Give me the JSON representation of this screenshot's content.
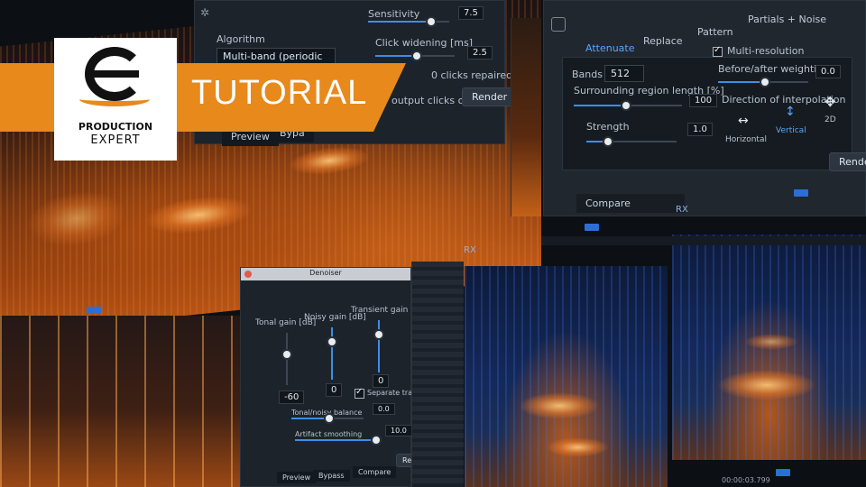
{
  "brand": {
    "logo_line1": "PRODUCTION",
    "logo_line2": "EXPERT",
    "banner_text": "TUTORIAL",
    "banner_color": "#e8891c"
  },
  "declick": {
    "algorithm_label": "Algorithm",
    "algorithm_value": "Multi-band (periodic clicks",
    "sensitivity_label": "Sensitivity",
    "sensitivity_value": "7.5",
    "sensitivity_level": 0.75,
    "click_widening_label": "Click widening [ms]",
    "click_widening_value": "2.5",
    "clicks_repaired": "0 clicks repaired",
    "output_clicks_only": "output clicks only",
    "render_label": "Render",
    "preview_label": "Preview",
    "bypass_label": "Bypa"
  },
  "spectral_repair": {
    "tabs": [
      "Attenuate",
      "Replace",
      "Pattern",
      "Partials + Noise"
    ],
    "active_tab": "Attenuate",
    "bands_label": "Bands",
    "bands_value": "512",
    "multi_resolution_label": "Multi-resolution",
    "surrounding_label": "Surrounding region length [%]",
    "surrounding_value": "100",
    "before_after_label": "Before/after weighting",
    "before_after_value": "0.0",
    "strength_label": "Strength",
    "strength_value": "1.0",
    "direction_label": "Direction of interpolation",
    "dir_horizontal": "Horizontal",
    "dir_vertical": "Vertical",
    "dir_2d": "2D",
    "compare_label": "Compare",
    "render_label": "Render",
    "rx_label": "RX"
  },
  "denoiser": {
    "title": "Denoiser",
    "tonal_gain_label": "Tonal gain [dB]",
    "tonal_gain_value": "-60",
    "noisy_gain_label": "Noisy gain [dB]",
    "noisy_gain_value": "0",
    "transient_gain_label": "Transient gain [dB]",
    "transient_gain_value": "0",
    "separate_transients_label": "Separate transients",
    "tonal_noisy_balance_label": "Tonal/noisy balance",
    "tonal_noisy_balance_value": "0.0",
    "artifact_smoothing_label": "Artifact smoothing",
    "artifact_smoothing_value": "10.0",
    "preview_label": "Preview",
    "bypass_label": "Bypass",
    "compare_label": "Compare",
    "render_label": "Render"
  },
  "rx_bottom": {
    "rx_label": "RX",
    "time_readout": "00:00:03.799",
    "accent_color": "#2b6fd6"
  }
}
